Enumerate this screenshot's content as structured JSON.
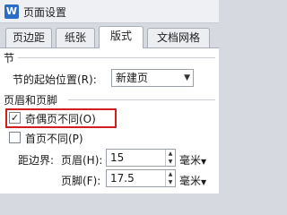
{
  "window": {
    "title": "页面设置",
    "app_icon": "W"
  },
  "tabs": [
    {
      "label": "页边距",
      "active": false
    },
    {
      "label": "纸张",
      "active": false
    },
    {
      "label": "版式",
      "active": true
    },
    {
      "label": "文档网格",
      "active": false
    }
  ],
  "section": {
    "group_label": "节",
    "start_label": "节的起始位置(R):",
    "start_value": "新建页"
  },
  "header_footer": {
    "group_label": "页眉和页脚",
    "odd_even_label": "奇偶页不同(O)",
    "odd_even_checked": true,
    "first_page_label": "首页不同(P)",
    "first_page_checked": false,
    "distance_label": "距边界:",
    "header_label": "页眉(H):",
    "header_value": "15",
    "footer_label": "页脚(F):",
    "footer_value": "17.5",
    "unit": "毫米"
  },
  "colors": {
    "highlight": "#d11f1f"
  }
}
